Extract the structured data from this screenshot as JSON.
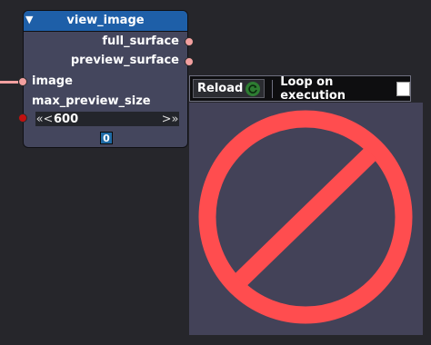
{
  "node": {
    "title": "view_image",
    "outputs": [
      "full_surface",
      "preview_surface"
    ],
    "inputs": [
      "image",
      "max_preview_size"
    ],
    "max_preview_size_value": "600",
    "arrow_left": "«<",
    "arrow_right": ">»",
    "counter": "0"
  },
  "toolbar": {
    "reload_label": "Reload",
    "loop_label": "Loop on execution",
    "loop_checked": false
  },
  "preview": {
    "icon": "prohibited-icon",
    "icon_color": "#ff4d4f"
  },
  "colors": {
    "header": "#1e5fa8",
    "node_body": "#44465d",
    "socket": "#f2a0a0",
    "socket_active": "#c21010",
    "preview_bg": "#434258"
  }
}
